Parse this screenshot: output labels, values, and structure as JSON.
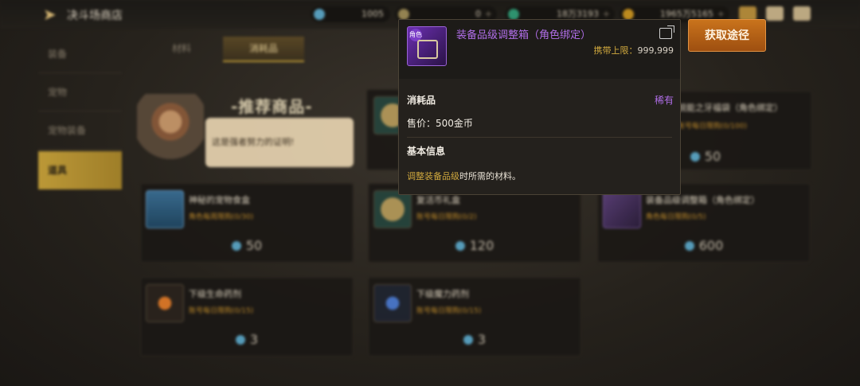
{
  "header": {
    "title": "决斗场商店",
    "resources": [
      {
        "icon": "crystal-icon",
        "value": "1005"
      },
      {
        "icon": "gold-coin-icon",
        "value": "0"
      },
      {
        "icon": "green-gem-icon",
        "value": "18万3193"
      },
      {
        "icon": "coin-icon",
        "value": "1965万5165"
      }
    ],
    "plus": "+"
  },
  "sidebar": {
    "items": [
      {
        "label": "装备"
      },
      {
        "label": "宠物"
      },
      {
        "label": "宠物装备"
      },
      {
        "label": "道具"
      }
    ]
  },
  "tabs": [
    {
      "label": "材料"
    },
    {
      "label": "消耗品"
    }
  ],
  "recommend": {
    "title": "-推荐商品-",
    "speech": "这是强者努力的证明!"
  },
  "cards": [
    {
      "name": "神秘的宠物食盒",
      "limit": "角色每周限购(0/30)",
      "price": "50"
    },
    {
      "name": "复活币礼盒",
      "limit": "账号每日限购(0/2)",
      "price": "120"
    },
    {
      "name": "装备品级调整箱（角色绑定）",
      "limit": "角色每日限购(0/5)",
      "price": "600"
    },
    {
      "name": "下级生命药剂",
      "limit": "账号每日限购(0/15)",
      "price": "3"
    },
    {
      "name": "下级魔力药剂",
      "limit": "账号每日限购(0/15)",
      "price": "3"
    },
    {
      "name": "锐能之牙福袋（角色绑定）",
      "limit": "账号每日限购(0/100)",
      "price": "50"
    }
  ],
  "tooltip": {
    "icon_badge": "角色",
    "name": "装备品级调整箱（角色绑定）",
    "carry_label": "携带上限：",
    "carry_value": "999,999",
    "type": "消耗品",
    "rarity": "稀有",
    "price": "售价：500金币",
    "basic_info": "基本信息",
    "desc_highlight": "调整装备品级",
    "desc_rest": "时所需的材料。"
  },
  "source_button": "获取途径",
  "colors": {
    "rarity_purple": "#b06ee8",
    "accent_gold": "#d1a93e",
    "button_orange": "#c9731c"
  }
}
